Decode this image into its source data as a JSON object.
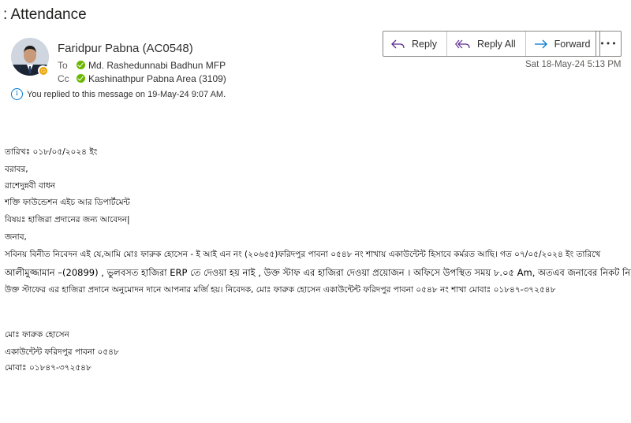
{
  "subject": ": Attendance",
  "sender": {
    "name": "Faridpur Pabna (AC0548)",
    "presence": "away"
  },
  "to": {
    "label": "To",
    "name": "Md. Rashedunnabi Badhun MFP"
  },
  "cc": {
    "label": "Cc",
    "name": "Kashinathpur Pabna Area (3109)"
  },
  "info_text": "You replied to this message on 19-May-24 9:07 AM.",
  "actions": {
    "reply": "Reply",
    "reply_all": "Reply All",
    "forward": "Forward",
    "more": "•••"
  },
  "date": "Sat 18-May-24 5:13 PM",
  "body_lines": [
    "তারিখঃ ০১৮/০৫/২০২৪ ইং",
    "বরাবর,",
    "রাশেদুন্নবী বাধন",
    "শক্তি ফাউন্ডেশন এইচ আর ডিপার্টমেন্ট",
    "বিষয়ঃ  হাজিরা প্রদানের জন্য আবেদন|",
    "জনাব,",
    "সবিনয় বিনীত নিবেদন এই যে,আমি মোঃ ফারুক হোসেন - ই আই এন নং (২০৬৫৫)ফরিদপুর পাবনা ০৫৪৮ নং শাখায় একাউন্টেন্ট হিসাবে কর্মরত আছি। গত ০৭/০৫/২০২৪ ইং তারিখে",
    "আলীমুজ্জামান –(20899) , ভুলবসত হাজিরা  ERP তে দেওয়া হয় নাই ,  উক্ত স্টাফ এর হাজিরা দেওয়া প্রয়োজন । অফিসে উপস্থিত সময় ৮.০৫ Am, অতএব জনাবের নিকট  নিবেদন",
    "উক্ত  স্টাফের এর হাজিরা প্রদানে  অনুমোদন দানে আপনার মর্জি হয়। নিবেদক, মোঃ ফারুক হোসেন একাউন্টেন্ট ফরিদপুর পাবনা ০৫৪৮ নং শাখা মোবাঃ ০১৮৪৭-৩৭২৫৪৮",
    "মোঃ ফারুক হোসেন",
    "একাউন্টেন্ট ফরিদপুর পাবনা ০৫৪৮",
    " মোবাঃ ০১৮৪৭-৩৭২৫৪৮"
  ]
}
